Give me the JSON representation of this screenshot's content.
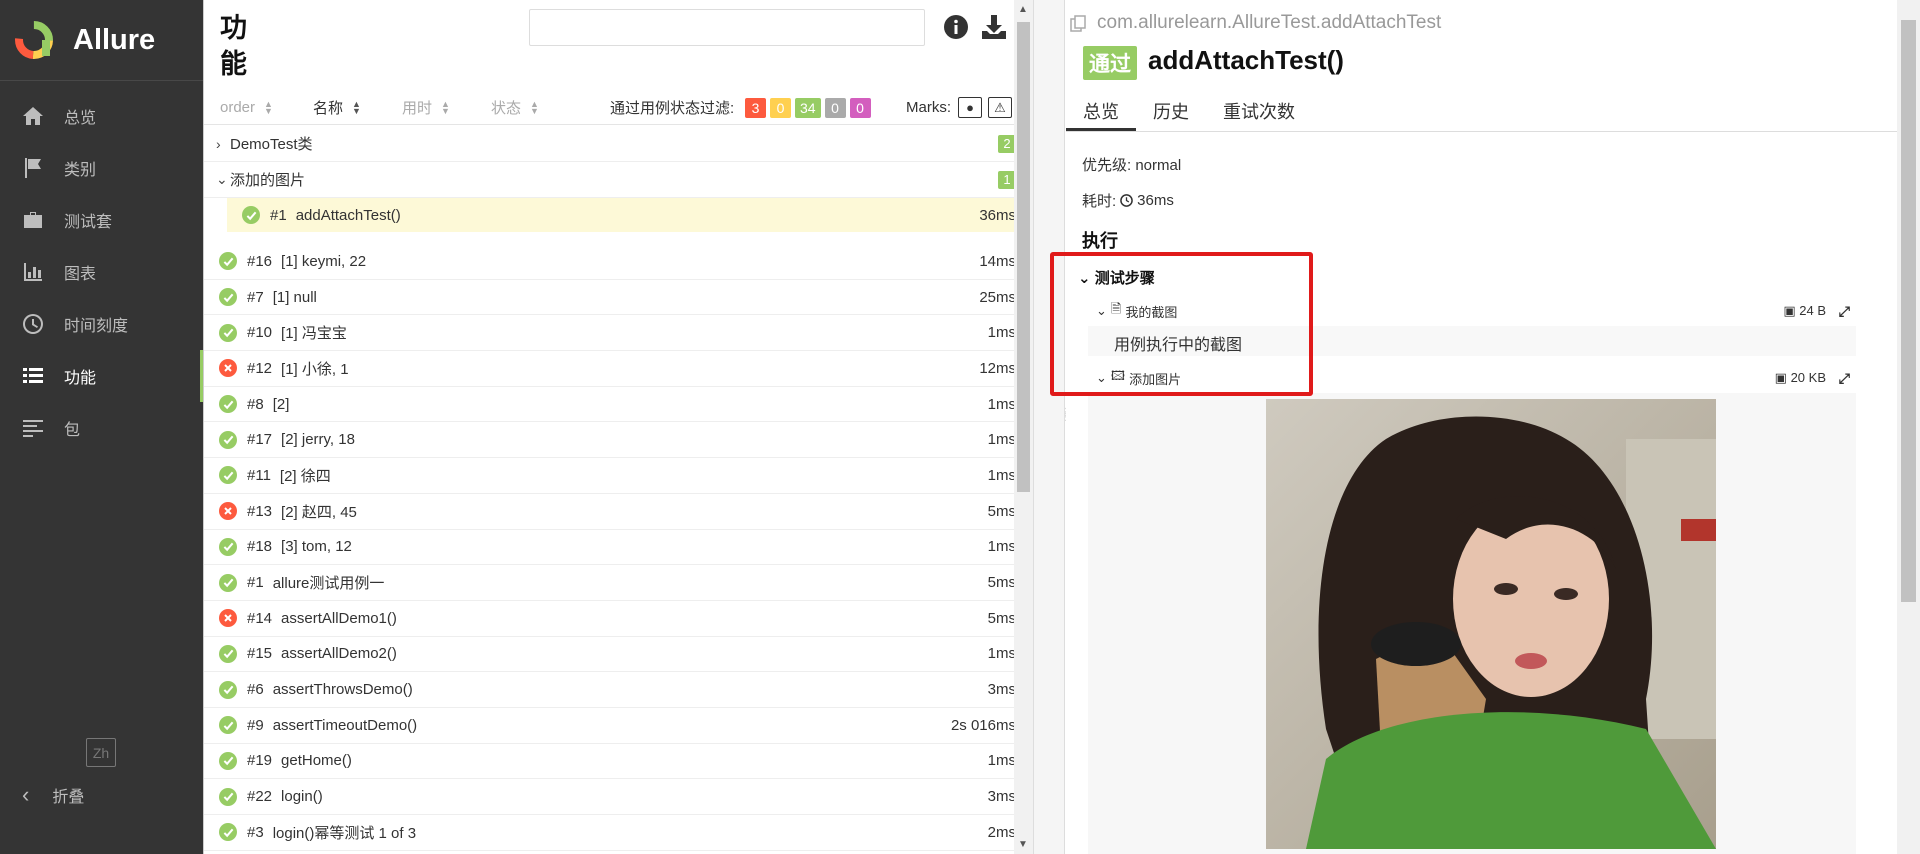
{
  "brand": {
    "name": "Allure"
  },
  "nav": {
    "items": [
      {
        "label": "总览",
        "icon": "home-icon"
      },
      {
        "label": "类别",
        "icon": "flag-icon"
      },
      {
        "label": "测试套",
        "icon": "briefcase-icon"
      },
      {
        "label": "图表",
        "icon": "bar-chart-icon"
      },
      {
        "label": "时间刻度",
        "icon": "clock-icon"
      },
      {
        "label": "功能",
        "icon": "list-icon",
        "active": true
      },
      {
        "label": "包",
        "icon": "package-icon"
      }
    ],
    "lang": "Zh",
    "collapse": "折叠"
  },
  "middle": {
    "title": "功能",
    "sort": [
      {
        "label": "order",
        "active": false
      },
      {
        "label": "名称",
        "active": true
      },
      {
        "label": "用时",
        "active": false
      },
      {
        "label": "状态",
        "active": false
      }
    ],
    "filter_label": "通过用例状态过滤:",
    "filters": [
      {
        "value": "3",
        "color": "#fd5a3e"
      },
      {
        "value": "0",
        "color": "#ffd050"
      },
      {
        "value": "34",
        "color": "#97cc64"
      },
      {
        "value": "0",
        "color": "#aaaaaa"
      },
      {
        "value": "0",
        "color": "#d35ebe"
      }
    ],
    "marks_label": "Marks:",
    "groups": [
      {
        "name": "DemoTest类",
        "count": "2",
        "expanded": false
      },
      {
        "name": "添加的图片",
        "count": "1",
        "expanded": true
      }
    ],
    "selected_case": {
      "num": "#1",
      "name": "addAttachTest()",
      "duration": "36ms"
    },
    "cases": [
      {
        "num": "#16",
        "name": "[1] keymi, 22",
        "duration": "14ms",
        "status": "passed"
      },
      {
        "num": "#7",
        "name": "[1] null",
        "duration": "25ms",
        "status": "passed"
      },
      {
        "num": "#10",
        "name": "[1] 冯宝宝",
        "duration": "1ms",
        "status": "passed"
      },
      {
        "num": "#12",
        "name": "[1] 小徐, 1",
        "duration": "12ms",
        "status": "failed"
      },
      {
        "num": "#8",
        "name": "[2]",
        "duration": "1ms",
        "status": "passed"
      },
      {
        "num": "#17",
        "name": "[2] jerry, 18",
        "duration": "1ms",
        "status": "passed"
      },
      {
        "num": "#11",
        "name": "[2] 徐四",
        "duration": "1ms",
        "status": "passed"
      },
      {
        "num": "#13",
        "name": "[2] 赵四, 45",
        "duration": "5ms",
        "status": "failed"
      },
      {
        "num": "#18",
        "name": "[3] tom, 12",
        "duration": "1ms",
        "status": "passed"
      },
      {
        "num": "#1",
        "name": "allure测试用例一",
        "duration": "5ms",
        "status": "passed"
      },
      {
        "num": "#14",
        "name": "assertAllDemo1()",
        "duration": "5ms",
        "status": "failed"
      },
      {
        "num": "#15",
        "name": "assertAllDemo2()",
        "duration": "1ms",
        "status": "passed"
      },
      {
        "num": "#6",
        "name": "assertThrowsDemo()",
        "duration": "3ms",
        "status": "passed"
      },
      {
        "num": "#9",
        "name": "assertTimeoutDemo()",
        "duration": "2s 016ms",
        "status": "passed"
      },
      {
        "num": "#19",
        "name": "getHome()",
        "duration": "1ms",
        "status": "passed"
      },
      {
        "num": "#22",
        "name": "login()",
        "duration": "3ms",
        "status": "passed"
      },
      {
        "num": "#3",
        "name": "login()幂等测试 1 of 3",
        "duration": "2ms",
        "status": "passed"
      }
    ]
  },
  "detail": {
    "full_name": "com.allurelearn.AllureTest.addAttachTest",
    "status": "通过",
    "title": "addAttachTest()",
    "tabs": [
      "总览",
      "历史",
      "重试次数"
    ],
    "severity_label": "优先级: normal",
    "duration_label": "耗时:",
    "duration": "36ms",
    "execution": "执行",
    "steps_header": "测试步骤",
    "attachments": [
      {
        "name": "我的截图",
        "size": "24 B",
        "content": "用例执行中的截图"
      },
      {
        "name": "添加图片",
        "size": "20 KB"
      }
    ]
  },
  "colors": {
    "passed": "#97cc64",
    "failed": "#fd5a3e",
    "sidebar": "#343434",
    "highlight": "#e01a1a"
  }
}
